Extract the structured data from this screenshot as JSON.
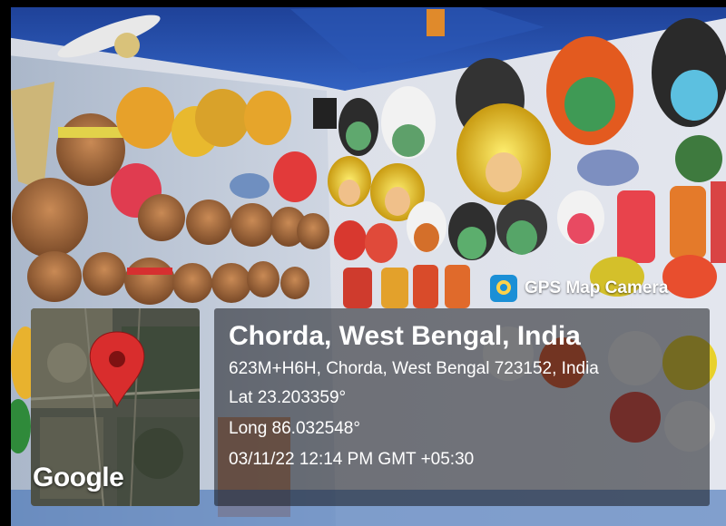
{
  "stamp": {
    "app_label": "GPS Map Camera",
    "logo_icon": "gps-map-camera-logo-icon",
    "map_watermark": "Google",
    "place_title": "Chorda, West Bengal, India",
    "address": "623M+H6H, Chorda, West Bengal 723152, India",
    "latitude": "Lat 23.203359°",
    "longitude": "Long 86.032548°",
    "datetime": "03/11/22 12:14 PM GMT +05:30",
    "pin_icon": "map-pin-icon"
  },
  "scene": {
    "subject": "wall of painted Chhau dance masks in a shop",
    "colors": {
      "ceiling": "#2a4fa8",
      "wall": "#d9dde8",
      "pin": "#d92d2d",
      "accent_gold": "#e8c21a"
    }
  }
}
